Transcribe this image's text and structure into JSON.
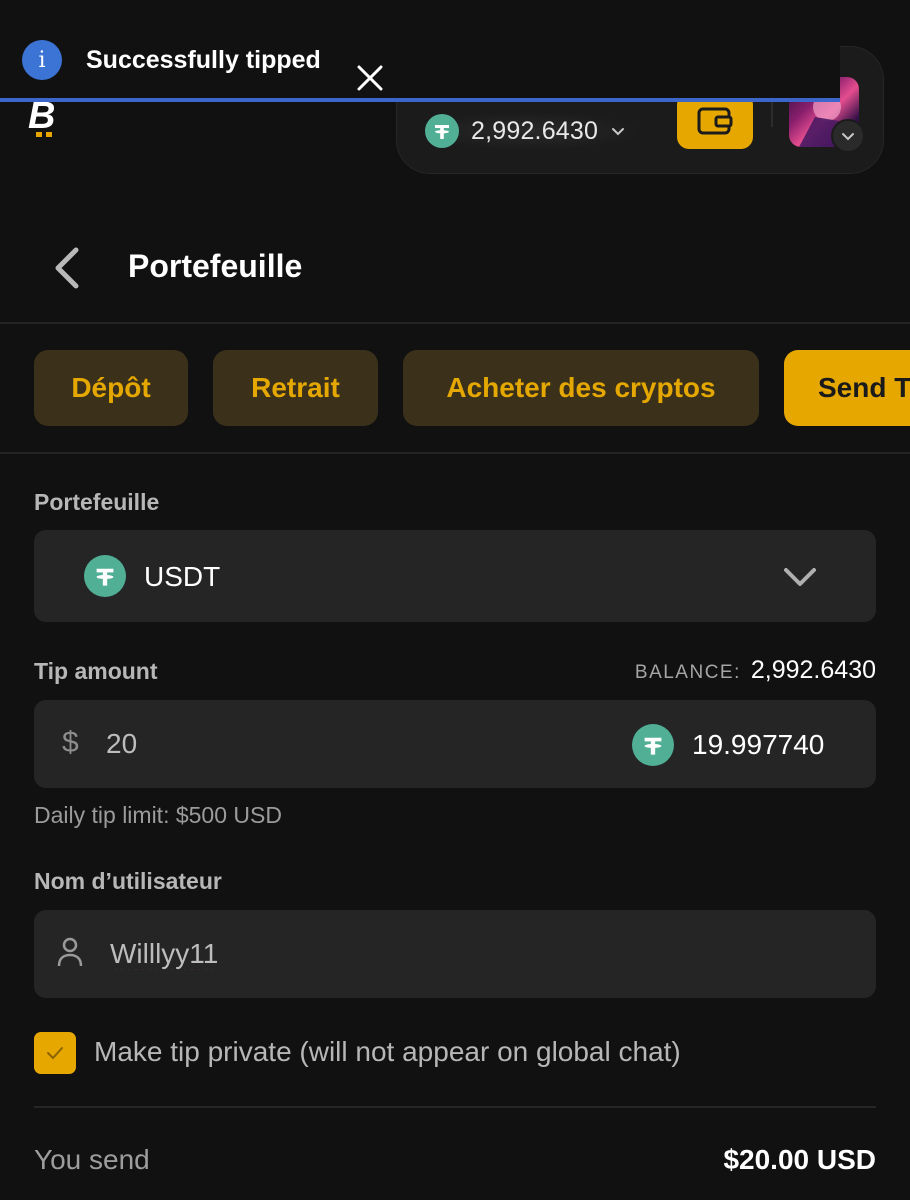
{
  "toast": {
    "message": "Successfully tipped",
    "icon": "info-icon"
  },
  "header": {
    "balance": "2,992.6430",
    "currency_icon": "tether-icon",
    "wallet_icon": "wallet-icon"
  },
  "page": {
    "title": "Portefeuille"
  },
  "tabs": [
    {
      "label": "Dépôt",
      "active": false
    },
    {
      "label": "Retrait",
      "active": false
    },
    {
      "label": "Acheter des cryptos",
      "active": false
    },
    {
      "label": "Send T",
      "active": true
    }
  ],
  "form": {
    "wallet_label": "Portefeuille",
    "wallet_currency": "USDT",
    "tip_label": "Tip amount",
    "balance_label": "BALANCE:",
    "balance_value": "2,992.6430",
    "currency_symbol": "$",
    "amount_value": "20",
    "crypto_value": "19.997740",
    "daily_limit": "Daily tip limit: $500 USD",
    "username_label": "Nom d’utilisateur",
    "username_value": "Willlyy11",
    "private_label": "Make tip private (will not appear on global chat)",
    "private_checked": true,
    "send_label": "You send",
    "send_value": "$20.00 USD"
  },
  "colors": {
    "accent": "#e6a800",
    "tab_bg": "#3b301a",
    "tether": "#50af95",
    "toast_border": "#3c66c9",
    "background": "#111111"
  }
}
